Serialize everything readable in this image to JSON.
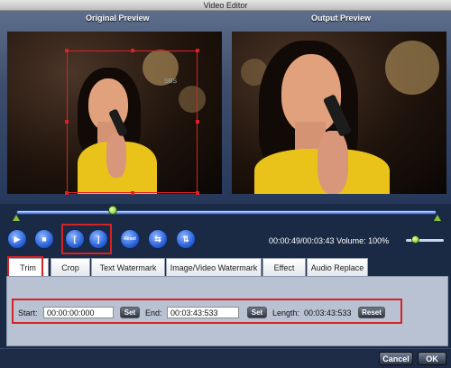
{
  "window": {
    "title": "Video Editor"
  },
  "preview": {
    "original_label": "Original Preview",
    "output_label": "Output Preview",
    "watermark": "SBS"
  },
  "playback": {
    "progress": 0.23,
    "time": "00:00:49/00:03:43",
    "volume_label": "Volume:",
    "volume_value": "100%",
    "volume_level": 0.25,
    "buttons": {
      "mark_in": "[",
      "mark_out": "]",
      "reset": "Reset"
    }
  },
  "tabs": [
    {
      "label": "Trim",
      "active": true
    },
    {
      "label": "Crop"
    },
    {
      "label": "Text Watermark"
    },
    {
      "label": "Image/Video Watermark"
    },
    {
      "label": "Effect"
    },
    {
      "label": "Audio Replace"
    }
  ],
  "trim": {
    "start_label": "Start:",
    "start_value": "00:00:00:000",
    "set_label": "Set",
    "end_label": "End:",
    "end_value": "00:03:43:533",
    "length_label": "Length:",
    "length_value": "00:03:43:533",
    "reset_label": "Reset"
  },
  "footer": {
    "cancel": "Cancel",
    "ok": "OK"
  },
  "colors": {
    "accent": "#2c63d9",
    "highlight": "#d52222",
    "slider": "#6bbf1a"
  }
}
